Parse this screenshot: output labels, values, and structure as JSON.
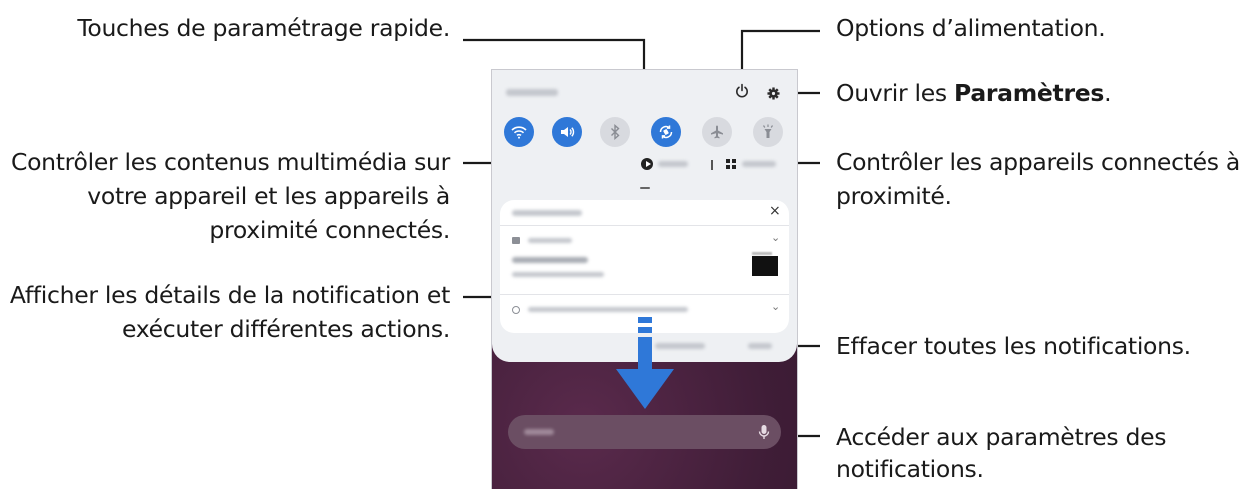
{
  "annotations": {
    "quick_settings": "Touches de paramétrage rapide.",
    "power": "Options d’alimentation.",
    "settings_prefix": "Ouvrir les ",
    "settings_bold": "Paramètres",
    "settings_suffix": ".",
    "media_line1": "Contrôler les contenus multimédia sur",
    "media_line2": "votre appareil et les appareils à",
    "media_line3": "proximité connectés.",
    "devices_line1": "Contrôler les appareils connectés à",
    "devices_line2": "proximité.",
    "details_line1": "Afficher les détails de la notification et",
    "details_line2": "exécuter différentes actions.",
    "clear": "Effacer toutes les notifications.",
    "notif_settings_line1": "Accéder aux paramètres des",
    "notif_settings_line2": "notifications."
  },
  "phone": {
    "quick_buttons": [
      {
        "icon": "wifi-icon",
        "state": "on"
      },
      {
        "icon": "sound-icon",
        "state": "on"
      },
      {
        "icon": "bluetooth-icon",
        "state": "off"
      },
      {
        "icon": "auto-rotate-icon",
        "state": "on"
      },
      {
        "icon": "airplane-mode-icon",
        "state": "off"
      },
      {
        "icon": "flashlight-icon",
        "state": "off"
      }
    ],
    "colors": {
      "accent": "#2f78d8",
      "panel": "#eef0f3",
      "wallpaper": "#3e1d35"
    }
  }
}
